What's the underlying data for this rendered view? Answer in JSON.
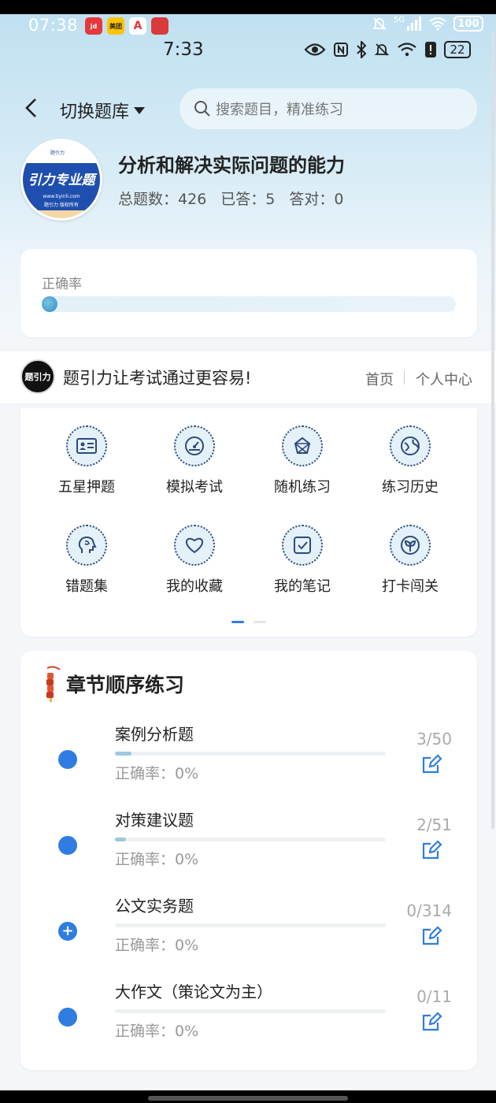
{
  "system_status": {
    "time": "07:38",
    "app_icons": [
      {
        "name": "app-icon-jd",
        "label": "jd",
        "color": "#e4393c"
      },
      {
        "name": "app-icon-meituan",
        "label": "美团",
        "color": "#ffc300"
      },
      {
        "name": "app-icon-a",
        "label": "A",
        "color": "#e23b3b"
      },
      {
        "name": "app-icon-red",
        "label": "",
        "color": "#d93a3a"
      }
    ],
    "network": "5G",
    "battery": "100"
  },
  "inner_status": {
    "time": "7:33",
    "battery": "22"
  },
  "header": {
    "switch_label": "切换题库",
    "search_placeholder": "搜索题目，精准练习"
  },
  "bank": {
    "logo_text": "引力专业题",
    "logo_url": "www.tiyinli.com",
    "logo_sub": "题引力 版权所有",
    "title": "分析和解决实际问题的能力",
    "total_label": "总题数：",
    "total": "426",
    "answered_label": "已答：",
    "answered": "5",
    "correct_label": "答对：",
    "correct": "0"
  },
  "accuracy": {
    "label": "正确率",
    "progress": 0
  },
  "banner": {
    "logo_text": "题引力",
    "slogan": "题引力让考试通过更容易!",
    "home": "首页",
    "user_center": "个人中心"
  },
  "features": [
    {
      "label": "五星押题",
      "icon": "id-card-icon"
    },
    {
      "label": "模拟考试",
      "icon": "gauge-icon"
    },
    {
      "label": "随机练习",
      "icon": "network-star-icon"
    },
    {
      "label": "练习历史",
      "icon": "globe-history-icon"
    },
    {
      "label": "错题集",
      "icon": "head-brain-icon"
    },
    {
      "label": "我的收藏",
      "icon": "heart-icon"
    },
    {
      "label": "我的笔记",
      "icon": "note-check-icon"
    },
    {
      "label": "打卡闯关",
      "icon": "sprout-icon"
    }
  ],
  "pager": {
    "pages": 2,
    "active": 0
  },
  "chapters": {
    "title": "章节顺序练习",
    "items": [
      {
        "name": "案例分析题",
        "progress_text": "3/50",
        "progress": 0.06,
        "acc_label": "正确率：",
        "acc": "0%",
        "marker": "dot"
      },
      {
        "name": "对策建议题",
        "progress_text": "2/51",
        "progress": 0.04,
        "acc_label": "正确率：",
        "acc": "0%",
        "marker": "dot"
      },
      {
        "name": "公文实务题",
        "progress_text": "0/314",
        "progress": 0,
        "acc_label": "正确率：",
        "acc": "0%",
        "marker": "plus"
      },
      {
        "name": "大作文（策论文为主）",
        "progress_text": "0/11",
        "progress": 0,
        "acc_label": "正确率：",
        "acc": "0%",
        "marker": "dot"
      }
    ]
  },
  "colors": {
    "accent": "#2f7de1",
    "progress_fill": "#9fc8dd",
    "logo_blue": "#1f4fae"
  }
}
